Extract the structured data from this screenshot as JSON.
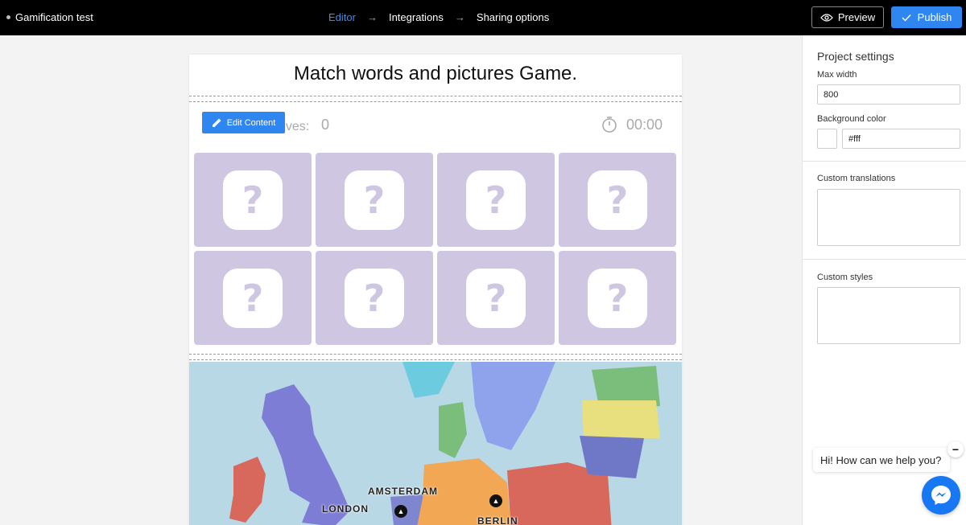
{
  "app": {
    "project_name": "Gamification test"
  },
  "steps": [
    {
      "label": "Editor",
      "active": true
    },
    {
      "label": "Integrations",
      "active": false
    },
    {
      "label": "Sharing options",
      "active": false
    }
  ],
  "toolbar": {
    "preview_label": "Preview",
    "publish_label": "Publish"
  },
  "game": {
    "title": "Match words and pictures Game.",
    "moves_label": "oves:",
    "moves_value": "0",
    "timer_value": "00:00",
    "edit_content_label": "Edit Content",
    "card_symbol": "?",
    "cards_count": 8
  },
  "map": {
    "cities": [
      "AMSTERDAM",
      "LONDON",
      "BERLIN"
    ]
  },
  "settings": {
    "title": "Project settings",
    "max_width_label": "Max width",
    "max_width_value": "800",
    "bg_color_label": "Background color",
    "bg_color_value": "#fff",
    "custom_translations_label": "Custom translations",
    "custom_styles_label": "Custom styles"
  },
  "chat": {
    "greeting": "Hi! How can we help you?",
    "close_symbol": "−"
  },
  "colors": {
    "accent": "#2f86f0",
    "card_bg": "#cfc7e2",
    "map_water": "#b9d8e6"
  },
  "icons": [
    "eye-icon",
    "check-icon",
    "pencil-icon",
    "stopwatch-icon",
    "messenger-icon",
    "museum-pin-icon"
  ]
}
